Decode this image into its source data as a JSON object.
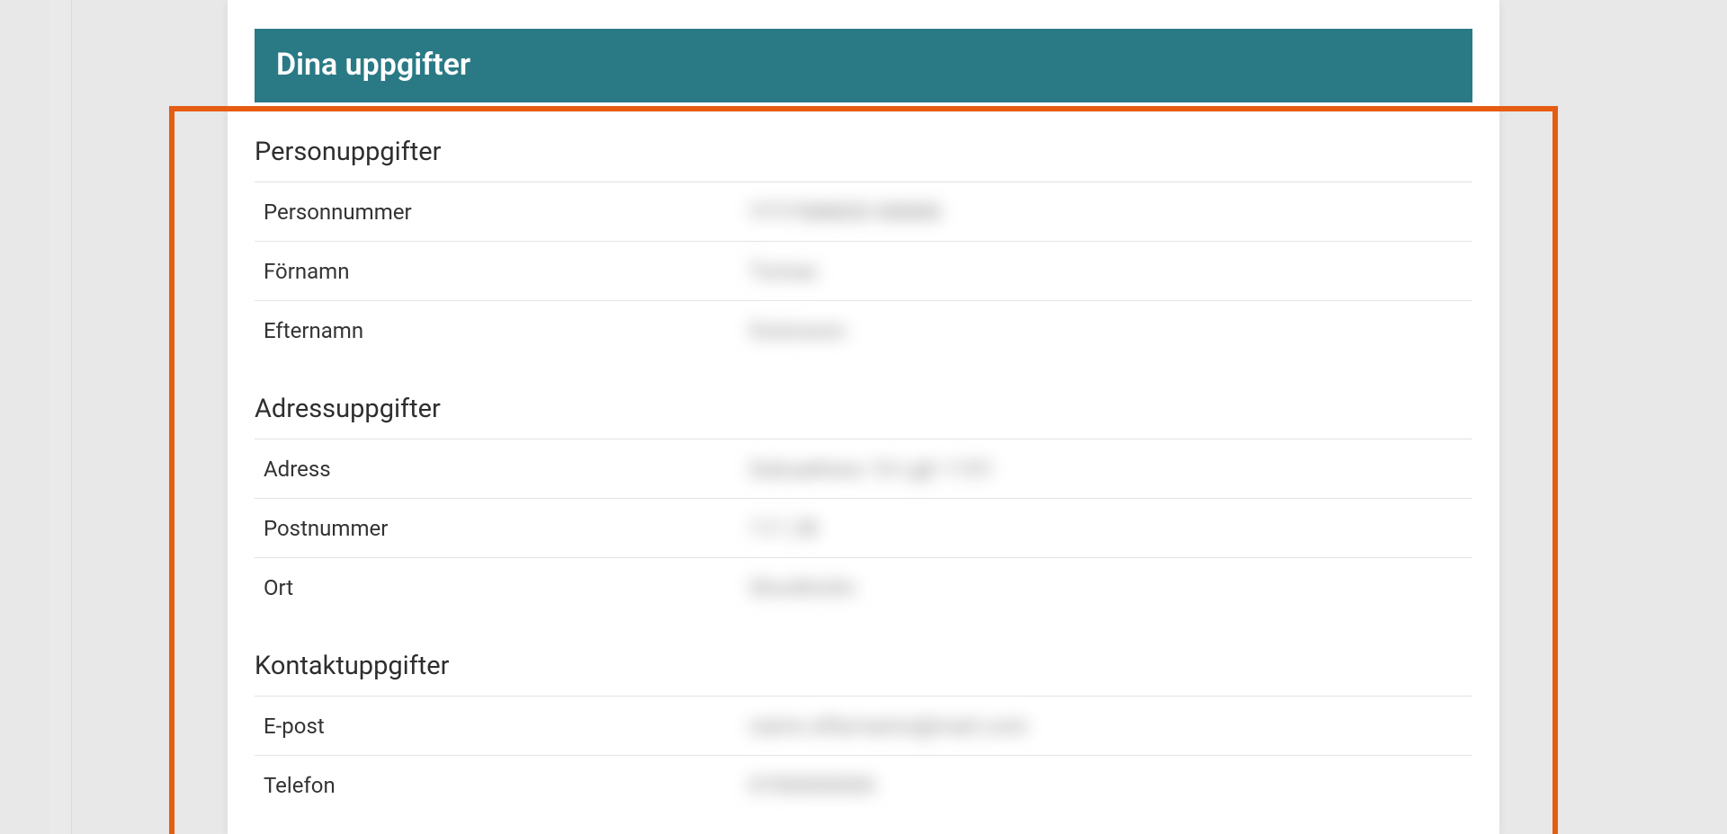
{
  "header": {
    "title": "Dina uppgifter"
  },
  "sections": {
    "person": {
      "title": "Personuppgifter",
      "rows": {
        "personnummer": {
          "label": "Personnummer",
          "value": "YYYYMMDD-NNNN"
        },
        "fornamn": {
          "label": "Förnamn",
          "value": "Tomas"
        },
        "efternamn": {
          "label": "Efternamn",
          "value": "Svensson"
        }
      }
    },
    "adress": {
      "title": "Adressuppgifter",
      "rows": {
        "adress": {
          "label": "Adress",
          "value": "Gatuadress 10 Lgh 1101"
        },
        "postnummer": {
          "label": "Postnummer",
          "value": "111 28"
        },
        "ort": {
          "label": "Ort",
          "value": "Stockholm"
        }
      }
    },
    "kontakt": {
      "title": "Kontaktuppgifter",
      "rows": {
        "epost": {
          "label": "E-post",
          "value": "namn.efternamn@mail.com"
        },
        "telefon": {
          "label": "Telefon",
          "value": "0700000000"
        }
      }
    }
  }
}
